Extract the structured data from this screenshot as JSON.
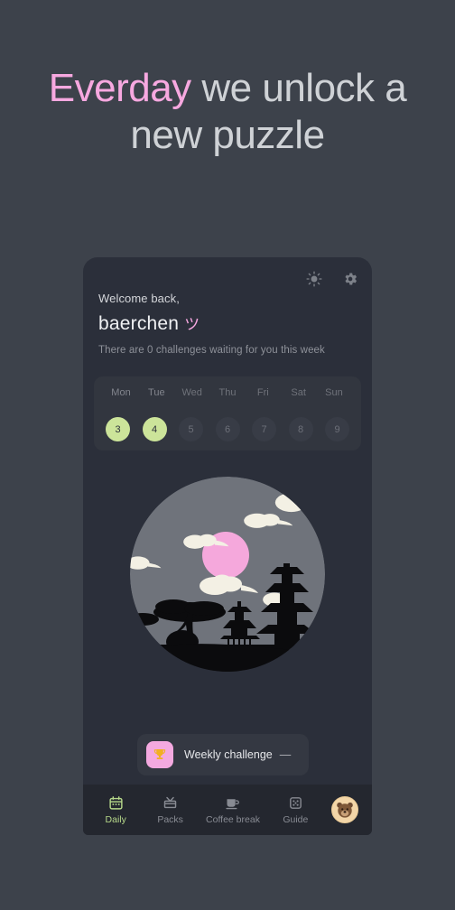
{
  "page": {
    "background_color": "#3d424b",
    "headline_accent_word": "Everday",
    "headline_rest": " we unlock a new puzzle",
    "accent_color": "#f7a8e0"
  },
  "card": {
    "background_color": "#2b2f3a",
    "top_icons": [
      {
        "name": "brightness-icon",
        "label": "sun-icon"
      },
      {
        "name": "settings-icon",
        "label": "gear-icon"
      }
    ],
    "greeting": {
      "welcome": "Welcome back,",
      "username": "baerchen",
      "emoji": "ツ",
      "subtitle": "There are 0 challenges waiting for you this week"
    },
    "week": {
      "days": [
        {
          "label": "Mon",
          "date": "3",
          "active": true
        },
        {
          "label": "Tue",
          "date": "4",
          "active": true
        },
        {
          "label": "Wed",
          "date": "5",
          "active": false
        },
        {
          "label": "Thu",
          "date": "6",
          "active": false
        },
        {
          "label": "Fri",
          "date": "7",
          "active": false
        },
        {
          "label": "Sat",
          "date": "8",
          "active": false
        },
        {
          "label": "Sun",
          "date": "9",
          "active": false
        }
      ],
      "active_color": "#cce49a",
      "inactive_color": "#383c46"
    },
    "illustration": {
      "name": "japanese-night-scene",
      "moon_color": "#f5a8dc",
      "sky_color": "#6f737b",
      "cloud_color": "#f3f0e4",
      "silhouette_color": "#0b0b0d"
    },
    "challenge": {
      "icon": "trophy-icon",
      "label": "Weekly challenge",
      "value": "—",
      "tile_color": "#f4a9e0"
    },
    "nav": {
      "items": [
        {
          "icon": "calendar-icon",
          "label": "Daily",
          "active": true
        },
        {
          "icon": "gift-box-icon",
          "label": "Packs",
          "active": false
        },
        {
          "icon": "coffee-cup-icon",
          "label": "Coffee break",
          "active": false
        },
        {
          "icon": "dice-icon",
          "label": "Guide",
          "active": false
        }
      ],
      "avatar": {
        "icon": "bear-avatar-icon",
        "background_color": "#f3d6a8"
      },
      "active_color": "#b6d88a"
    }
  }
}
